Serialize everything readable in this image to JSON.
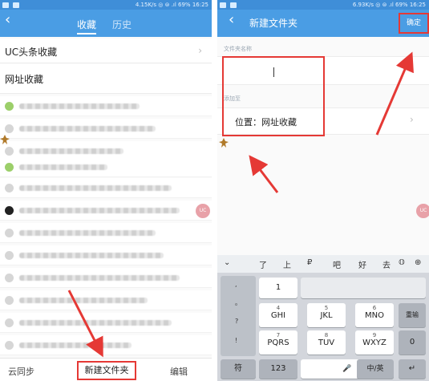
{
  "left": {
    "status": {
      "left_text": "N ⊙ ⊡",
      "right_text": "4.15K/s  ◎ ⊜ .ıl 69%  16:25"
    },
    "tabs": {
      "favorites": "收藏",
      "history": "历史"
    },
    "rows": {
      "uc_news": "UC头条收藏",
      "web_favorites": "网址收藏"
    },
    "bottom": {
      "sync": "云同步",
      "new_folder": "新建文件夹",
      "edit": "编辑"
    },
    "float_button": "UC"
  },
  "right": {
    "status": {
      "left_text": "N ⊙ ⊡",
      "right_text": "6.93K/s  ◎ ⊜ .ıl 69%  16:25"
    },
    "title": "新建文件夹",
    "confirm": "确定",
    "name_label": "文件夹名称",
    "add_label": "添加至",
    "location": "位置：网址收藏",
    "float_button": "UC",
    "keyboard": {
      "candidates": [
        "了",
        "上",
        "₽",
        "吧",
        "好",
        "去",
        "𝕆",
        "⊕"
      ],
      "punct": [
        ",",
        "。",
        "?",
        "!"
      ],
      "row1": [
        {
          "main": "1"
        }
      ],
      "row2": [
        {
          "main": "GHI",
          "sub": "4"
        },
        {
          "main": "JKL",
          "sub": "5"
        },
        {
          "main": "MNO",
          "sub": "6"
        },
        {
          "main": "重输"
        }
      ],
      "row3": [
        {
          "main": "PQRS",
          "sub": "7"
        },
        {
          "main": "TUV",
          "sub": "8"
        },
        {
          "main": "WXYZ",
          "sub": "9"
        },
        {
          "main": "0"
        }
      ],
      "row4": [
        {
          "main": "符"
        },
        {
          "main": "123"
        },
        {
          "main": "中/英"
        },
        {
          "main": "↵"
        }
      ]
    }
  }
}
